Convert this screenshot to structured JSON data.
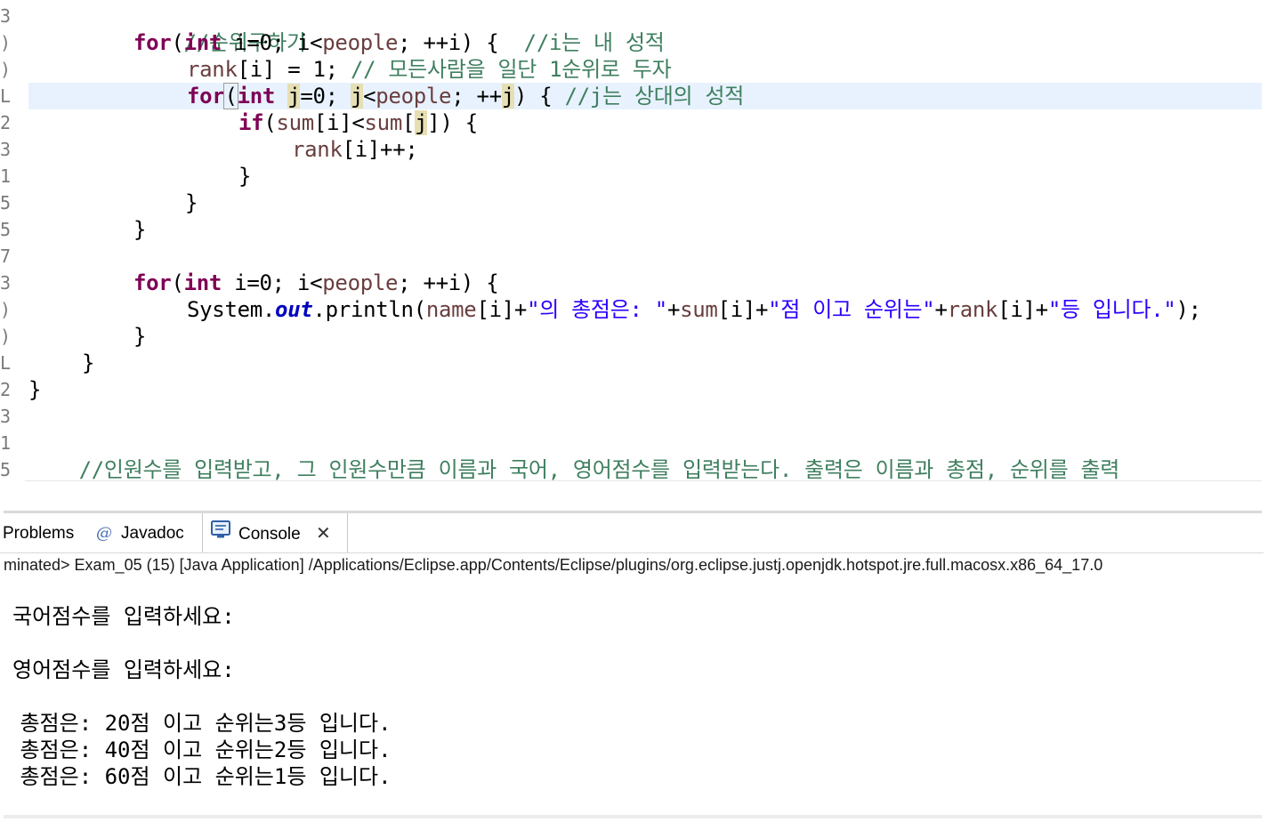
{
  "editor": {
    "gutter": [
      "3",
      ")",
      ")",
      "L",
      "2",
      "3",
      "1",
      "5",
      "5",
      "7",
      "3",
      ")",
      ")",
      "L",
      "2",
      "3",
      "1",
      "5"
    ],
    "line01": {
      "comment": "//순위구하기"
    },
    "line02": {
      "kw_for": "for",
      "p1": "(",
      "kw_int": "int",
      "p2": " i=0; i<",
      "var_people": "people",
      "p3": "; ++i) {  ",
      "comment": "//i는 내 성적"
    },
    "line03": {
      "var_rank": "rank",
      "p1": "[i] = 1; ",
      "comment": "// 모든사람을 일단 1순위로 두자"
    },
    "line04": {
      "kw_for": "for",
      "bracket": "(",
      "kw_int": "int",
      "p1": " ",
      "j1": "j",
      "p2": "=0; ",
      "j2": "j",
      "p3": "<",
      "var_people": "people",
      "p4": "; ++",
      "j3": "j",
      "p5": ") { ",
      "comment": "//j는 상대의 성적"
    },
    "line05": {
      "kw_if": "if",
      "p1": "(",
      "var_sum1": "sum",
      "p2": "[i]<",
      "var_sum2": "sum",
      "p3": "[",
      "j": "j",
      "p4": "]) {"
    },
    "line06": {
      "var_rank": "rank",
      "p1": "[i]++;"
    },
    "line07": {
      "text": "}"
    },
    "line08": {
      "text": "}"
    },
    "line09": {
      "text": "}"
    },
    "line11": {
      "kw_for": "for",
      "p1": "(",
      "kw_int": "int",
      "p2": " i=0; i<",
      "var_people": "people",
      "p3": "; ++i) {"
    },
    "line12": {
      "p1": "System.",
      "field_out": "out",
      "p2": ".println(",
      "var_name": "name",
      "p3": "[i]+",
      "str1": "\"의 총점은: \"",
      "p4": "+",
      "var_sum": "sum",
      "p5": "[i]+",
      "str2": "\"점 이고 순위는\"",
      "p6": "+",
      "var_rank": "rank",
      "p7": "[i]+",
      "str3": "\"등 입니다.\"",
      "p8": ");"
    },
    "line13": {
      "text": "}"
    },
    "line14": {
      "text": "}"
    },
    "line15": {
      "text": "}"
    },
    "line17": {
      "comment": "//인원수를 입력받고, 그 인원수만큼 이름과 국어, 영어점수를 입력받는다. 출력은 이름과 총점, 순위를 출력"
    }
  },
  "panel": {
    "tabs": {
      "problems": "Problems",
      "javadoc": "Javadoc",
      "javadoc_icon": "@",
      "console": "Console",
      "close": "✕"
    },
    "path": "minated> Exam_05 (15) [Java Application] /Applications/Eclipse.app/Contents/Eclipse/plugins/org.eclipse.justj.openjdk.hotspot.jre.full.macosx.x86_64_17.0"
  },
  "console": {
    "lines": [
      "국어점수를 입력하세요:",
      "영어점수를 입력하세요:",
      " 총점은: 20점 이고 순위는3등 입니다.",
      " 총점은: 40점 이고 순위는2등 입니다.",
      " 총점은: 60점 이고 순위는1등 입니다."
    ]
  },
  "colors": {
    "keyword": "#7f0055",
    "comment": "#3f7f5f",
    "string": "#2a00ff",
    "variable": "#6a3e3e",
    "field": "#0000c0",
    "current_line": "#e8f2fe",
    "occurrence": "#e6dfb4"
  }
}
